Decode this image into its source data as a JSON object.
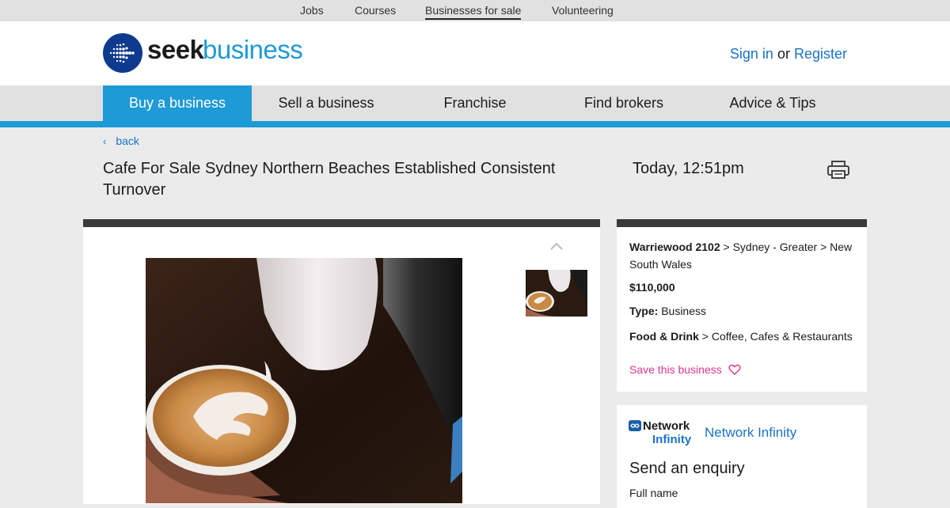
{
  "topnav": {
    "items": [
      "Jobs",
      "Courses",
      "Businesses for sale",
      "Volunteering"
    ],
    "active": "Businesses for sale"
  },
  "header": {
    "logo_seek": "seek",
    "logo_business": "business",
    "sign_in": "Sign in",
    "or": "or",
    "register": "Register"
  },
  "mainnav": {
    "items": [
      "Buy a business",
      "Sell a business",
      "Franchise",
      "Find brokers",
      "Advice & Tips"
    ],
    "active": "Buy a business"
  },
  "page": {
    "back_label": "back",
    "title": "Cafe For Sale Sydney Northern Beaches Established Consistent Turnover",
    "date": "Today, 12:51pm"
  },
  "listing": {
    "suburb": "Warriewood 2102",
    "region": " > Sydney - Greater > New South Wales",
    "price": "$110,000",
    "type_label": "Type:",
    "type_value": " Business",
    "category": "Food & Drink",
    "subcategory": " > Coffee, Cafes & Restaurants",
    "save_label": "Save this business"
  },
  "agency": {
    "logo_line1": "Network",
    "logo_line2": "Infinity",
    "name": "Network Infinity",
    "enquiry_title": "Send an enquiry",
    "fullname_label": "Full name"
  },
  "colors": {
    "accent": "#1e9ad6",
    "link": "#1a73c8",
    "save": "#e0358f",
    "dark_bar": "#3a3a3a"
  },
  "icons": [
    "back-chevron-icon",
    "print-icon",
    "chevron-up-icon",
    "heart-icon",
    "seek-logo-icon"
  ]
}
